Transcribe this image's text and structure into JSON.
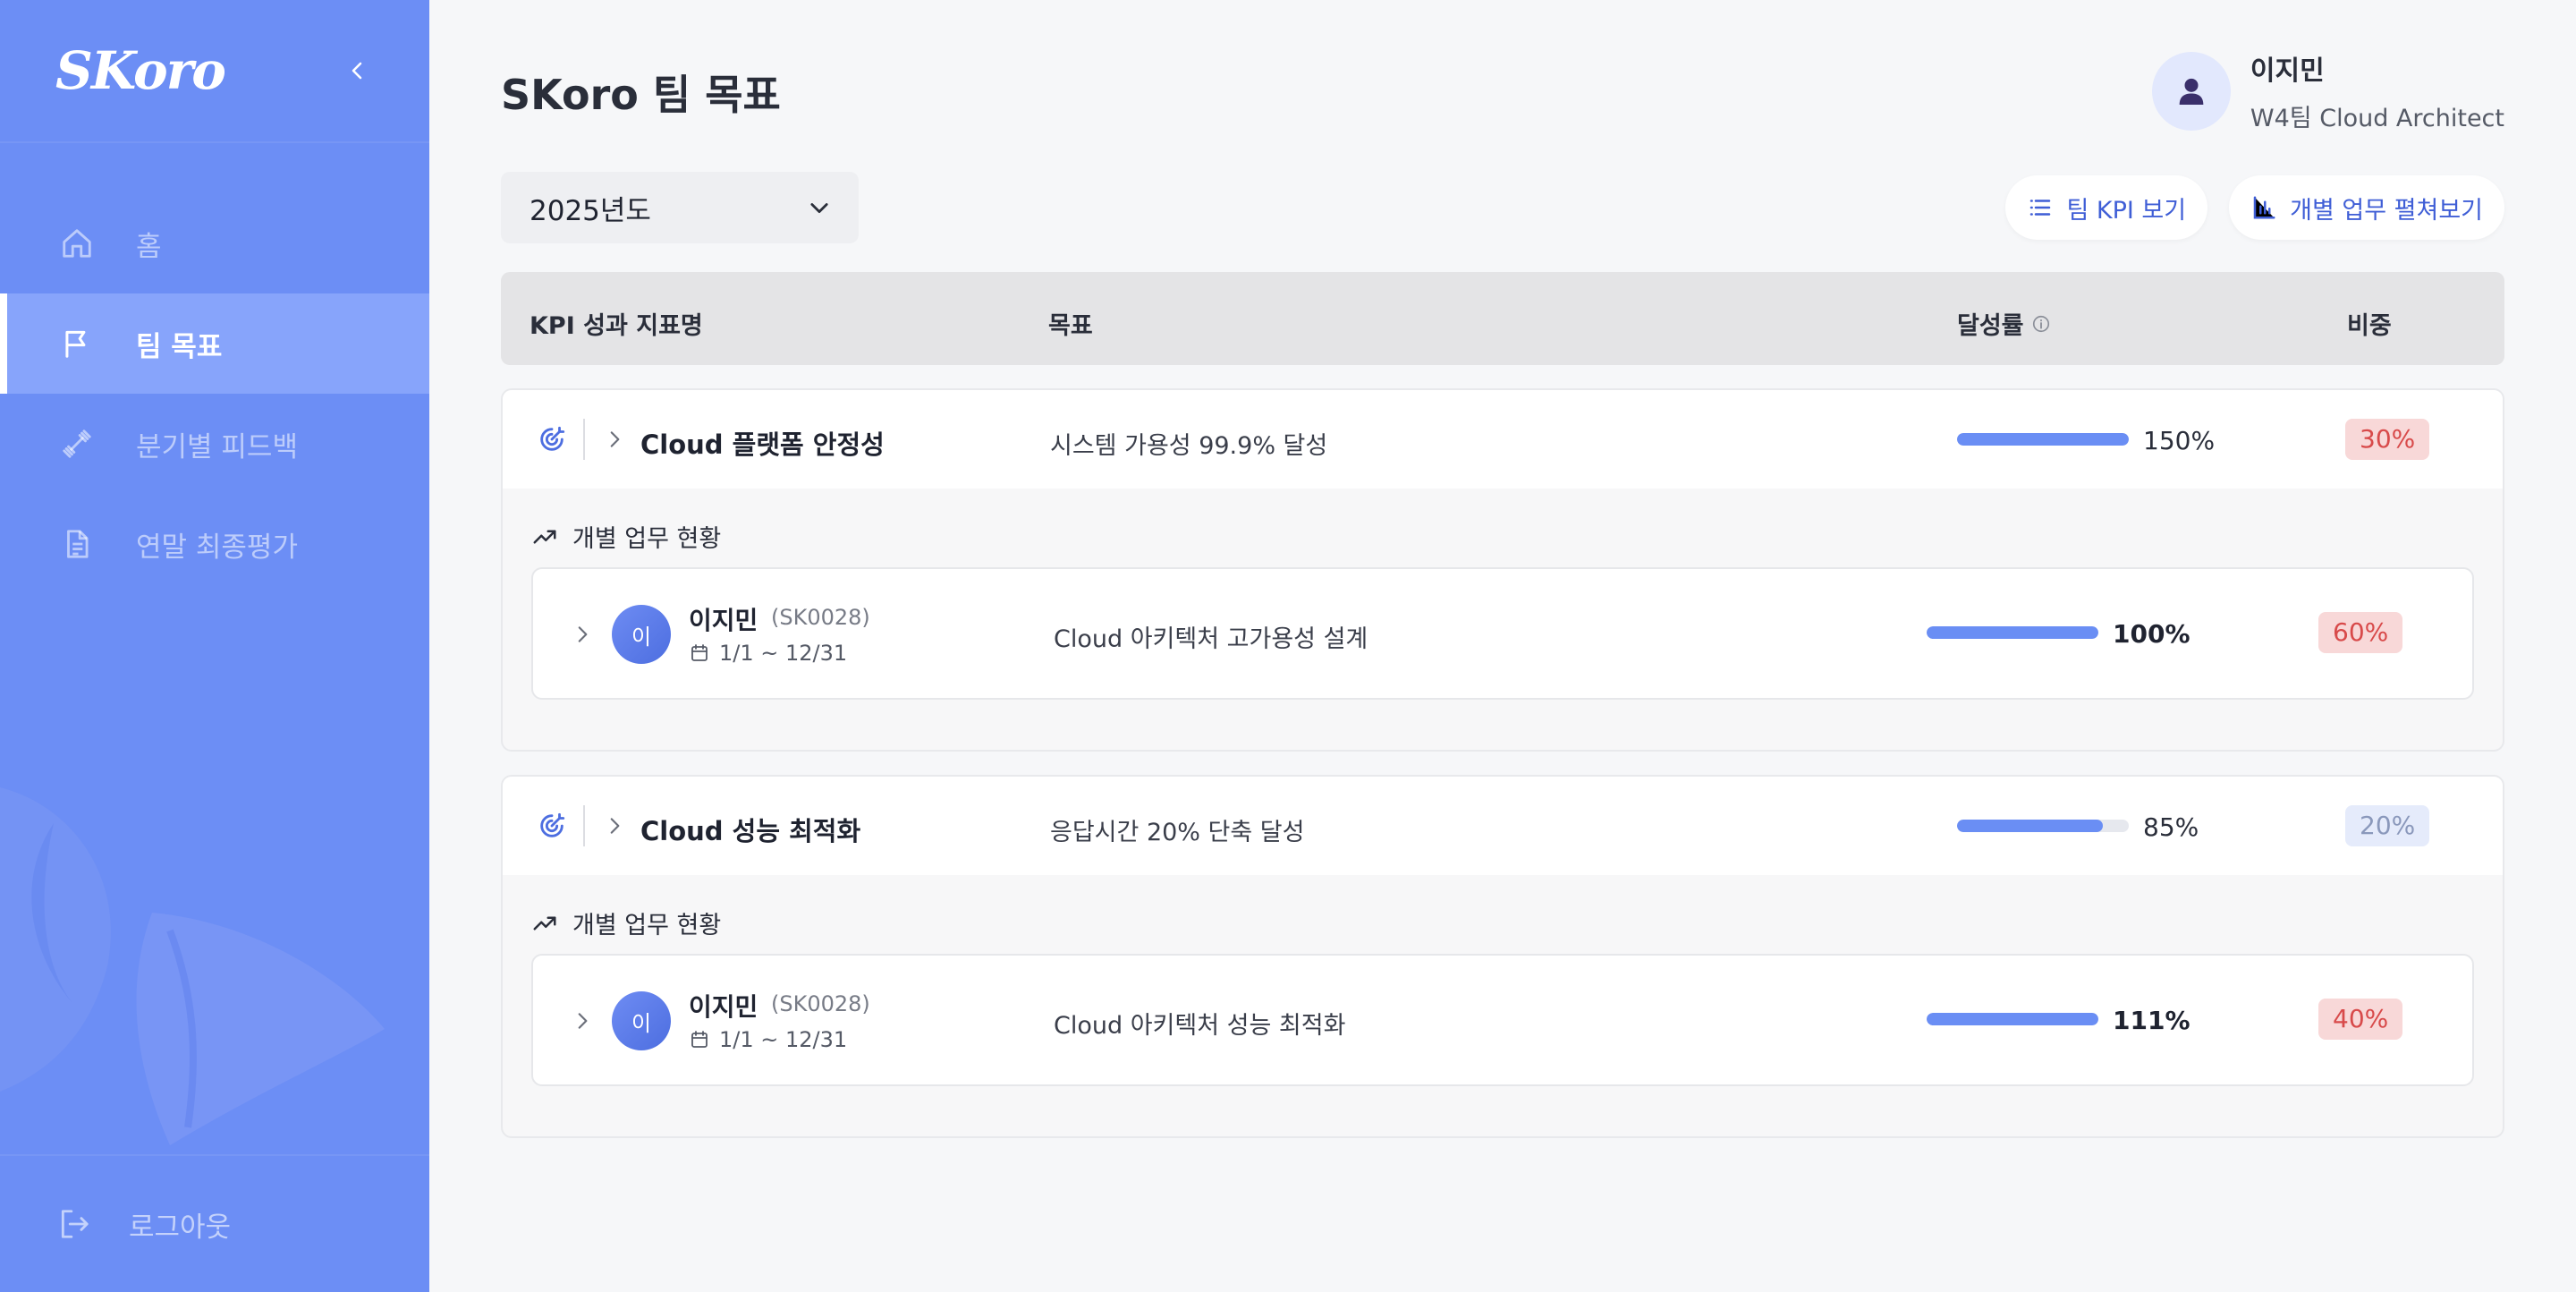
{
  "app": {
    "logo": "SKoro"
  },
  "sidebar": {
    "items": [
      {
        "label": "홈",
        "icon": "home-icon",
        "active": false
      },
      {
        "label": "팀 목표",
        "icon": "flag-icon",
        "active": true
      },
      {
        "label": "분기별 피드백",
        "icon": "dumbbell-icon",
        "active": false
      },
      {
        "label": "연말 최종평가",
        "icon": "document-icon",
        "active": false
      }
    ],
    "logout": "로그아웃"
  },
  "header": {
    "title": "SKoro 팀 목표",
    "user": {
      "name": "이지민",
      "role": "W4팀 Cloud Architect"
    }
  },
  "filters": {
    "year": "2025년도"
  },
  "actions": {
    "team_kpi": "팀 KPI 보기",
    "individual": "개별 업무 펼쳐보기"
  },
  "table": {
    "headers": {
      "kpi": "KPI 성과 지표명",
      "goal": "목표",
      "rate": "달성률",
      "weight": "비중"
    },
    "sub_title": "개별 업무 현황",
    "groups": [
      {
        "kpi": "Cloud 플랫폼 안정성",
        "goal": "시스템 가용성 99.9% 달성",
        "rate": "150%",
        "progress": 1.0,
        "weight": "30%",
        "tasks": [
          {
            "avatar": "이",
            "name": "이지민",
            "id": "(SK0028)",
            "period": "1/1 ~ 12/31",
            "goal": "Cloud 아키텍처 고가용성 설계",
            "rate": "100%",
            "progress": 1.0,
            "weight": "60%"
          }
        ]
      },
      {
        "kpi": "Cloud 성능 최적화",
        "goal": "응답시간 20% 단축 달성",
        "rate": "85%",
        "progress": 0.85,
        "weight": "20%",
        "tasks": [
          {
            "avatar": "이",
            "name": "이지민",
            "id": "(SK0028)",
            "period": "1/1 ~ 12/31",
            "goal": "Cloud 아키텍처 성능 최적화",
            "rate": "111%",
            "progress": 1.0,
            "weight": "40%"
          }
        ]
      }
    ]
  }
}
